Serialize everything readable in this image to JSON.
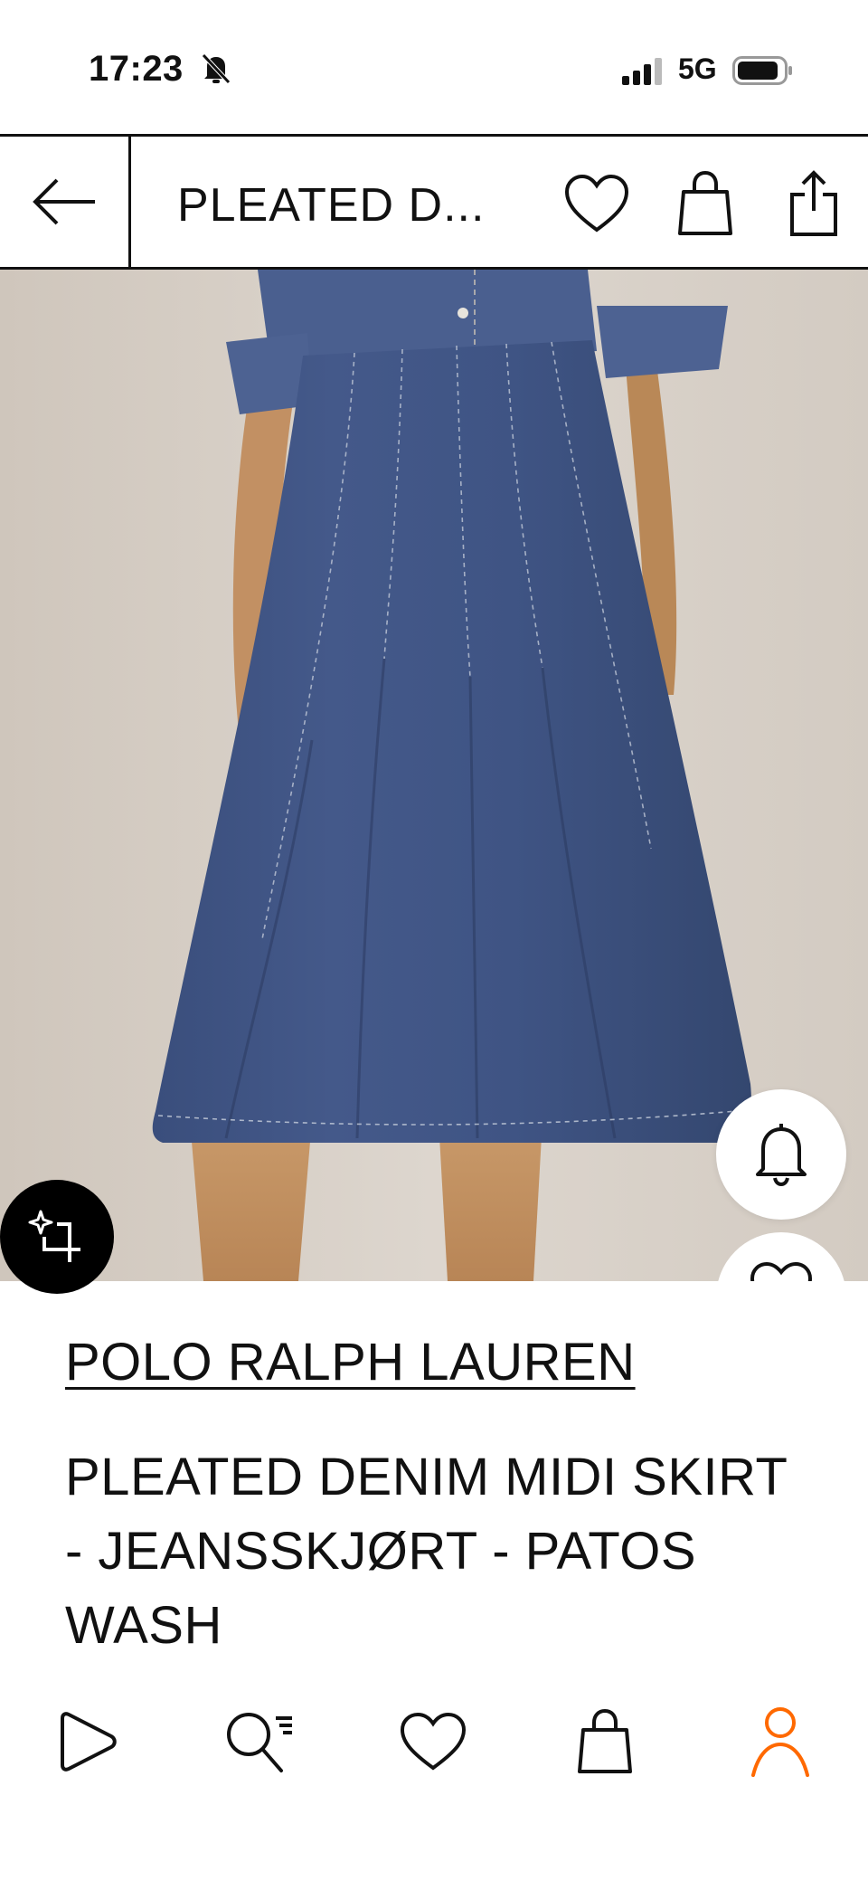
{
  "status_bar": {
    "time": "17:23",
    "network": "5G",
    "icons": [
      "bell-slash-icon",
      "signal-bars-icon",
      "battery-icon"
    ]
  },
  "header": {
    "title": "PLEATED D...",
    "icons": [
      "arrow-left-icon",
      "heart-icon",
      "shopping-bag-icon",
      "share-icon"
    ]
  },
  "product": {
    "brand": "POLO RALPH LAUREN",
    "name": "PLEATED DENIM MIDI SKIRT - JEANSSKJØRT - PATOS WASH"
  },
  "floating_actions": [
    "bell-icon",
    "heart-icon",
    "sparkle-crop-icon"
  ],
  "tab_bar": {
    "items": [
      {
        "name": "home",
        "icon": "play-icon"
      },
      {
        "name": "search",
        "icon": "search-icon"
      },
      {
        "name": "wishlist",
        "icon": "heart-icon"
      },
      {
        "name": "bag",
        "icon": "shopping-bag-icon"
      },
      {
        "name": "profile",
        "icon": "user-icon",
        "active": true
      }
    ]
  },
  "colors": {
    "accent": "#ff6900",
    "denim": "#3d5586",
    "backdrop": "#d9d2ca",
    "text": "#111111"
  }
}
